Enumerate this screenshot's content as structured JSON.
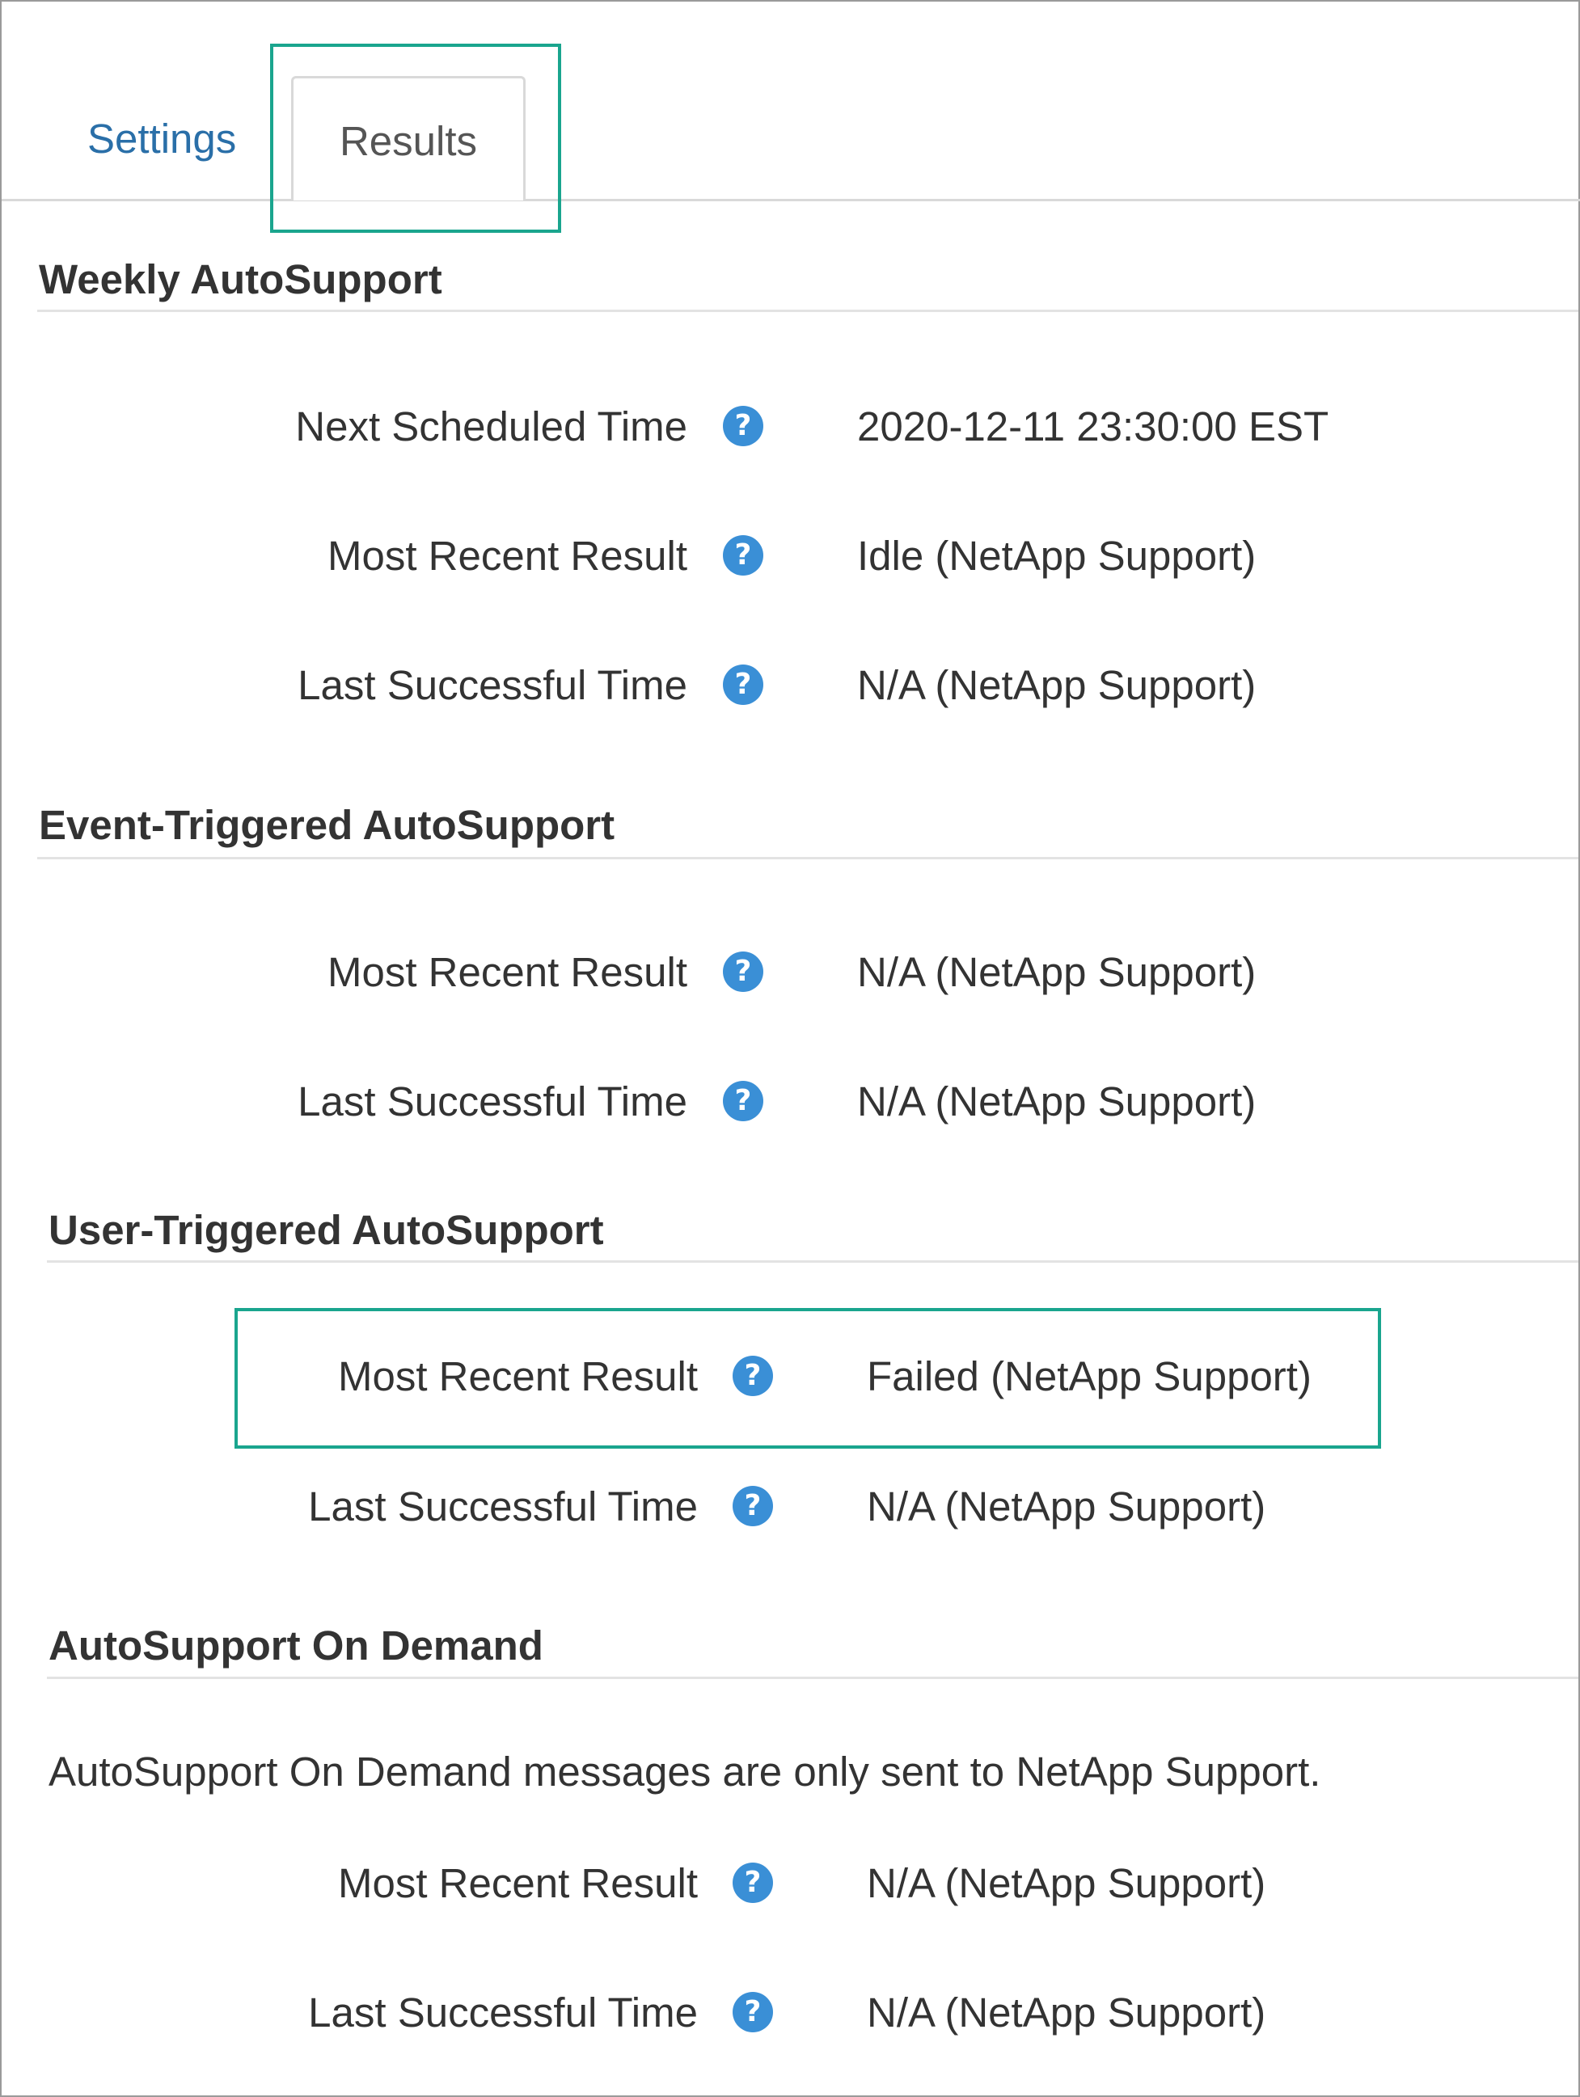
{
  "tabs": {
    "settings": "Settings",
    "results": "Results"
  },
  "help_icon_glyph": "?",
  "sections": {
    "weekly": {
      "title": "Weekly AutoSupport",
      "rows": [
        {
          "label": "Next Scheduled Time",
          "value": "2020-12-11 23:30:00 EST"
        },
        {
          "label": "Most Recent Result",
          "value": "Idle (NetApp Support)"
        },
        {
          "label": "Last Successful Time",
          "value": "N/A (NetApp Support)"
        }
      ]
    },
    "event": {
      "title": "Event-Triggered AutoSupport",
      "rows": [
        {
          "label": "Most Recent Result",
          "value": "N/A (NetApp Support)"
        },
        {
          "label": "Last Successful Time",
          "value": "N/A (NetApp Support)"
        }
      ]
    },
    "user": {
      "title": "User-Triggered AutoSupport",
      "rows": [
        {
          "label": "Most Recent Result",
          "value": "Failed (NetApp Support)"
        },
        {
          "label": "Last Successful Time",
          "value": "N/A (NetApp Support)"
        }
      ]
    },
    "on_demand": {
      "title": "AutoSupport On Demand",
      "note": "AutoSupport On Demand messages are only sent to NetApp Support.",
      "rows": [
        {
          "label": "Most Recent Result",
          "value": "N/A (NetApp Support)"
        },
        {
          "label": "Last Successful Time",
          "value": "N/A (NetApp Support)"
        }
      ]
    }
  },
  "colors": {
    "highlight": "#1aa58e",
    "link": "#2a6fa8",
    "help_icon": "#3a8fd6"
  },
  "icons": [
    "help-icon"
  ]
}
